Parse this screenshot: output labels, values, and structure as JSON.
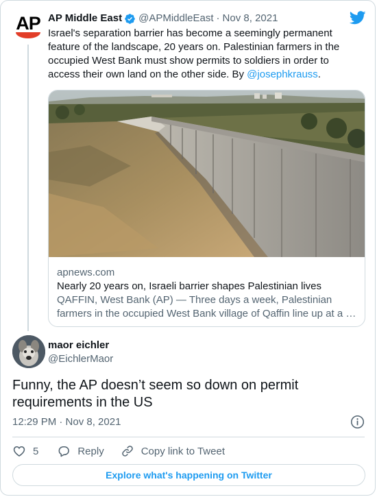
{
  "parent": {
    "name": "AP Middle East",
    "handle": "@APMiddleEast",
    "separator": "·",
    "date": "Nov 8, 2021",
    "avatar_text": "AP",
    "text_main": "Israel's separation barrier has become a seemingly permanent feature of the landscape, 20 years on. Palestinian farmers in the occupied West Bank must show permits to soldiers in order to access their own land on the other side. By ",
    "mention": "@josephkrauss",
    "text_end": ".",
    "link_card": {
      "domain": "apnews.com",
      "title": "Nearly 20 years on, Israeli barrier shapes Palestinian lives",
      "description": "QAFFIN, West Bank (AP) — Three days a week, Palestinian farmers in the occupied West Bank village of Qaffin line up at a …"
    }
  },
  "reply": {
    "name": "maor eichler",
    "handle": "@EichlerMaor",
    "text": "Funny, the AP doesn’t seem so down on permit requirements in the US",
    "timestamp": "12:29 PM · Nov 8, 2021"
  },
  "actions": {
    "like_count": "5",
    "reply_label": "Reply",
    "copy_label": "Copy link to Tweet"
  },
  "explore_label": "Explore what's happening on Twitter",
  "colors": {
    "accent": "#1d9bf0",
    "text": "#0f1419",
    "secondary": "#536471",
    "border": "#cfd9de",
    "ap_red": "#e23d28"
  }
}
